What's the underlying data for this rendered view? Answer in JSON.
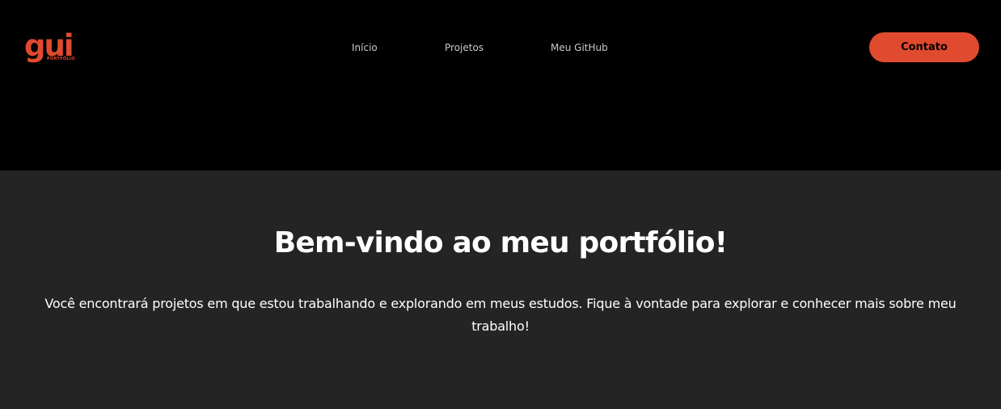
{
  "brand": {
    "logo_text": "gui",
    "logo_subtext": "PORTFÓLIO"
  },
  "nav": {
    "items": [
      {
        "label": "Início"
      },
      {
        "label": "Projetos"
      },
      {
        "label": "Meu GitHub"
      }
    ]
  },
  "header": {
    "contact_label": "Contato"
  },
  "hero": {
    "title": "Bem-vindo ao meu portfólio!",
    "description": "Você encontrará projetos em que estou trabalhando e explorando em meus estudos. Fique à vontade para explorar e conhecer mais sobre meu trabalho!"
  },
  "colors": {
    "accent": "#e04a2f",
    "header_bg": "#000000",
    "hero_bg": "#242424",
    "nav_text": "#c9c9c9",
    "title_text": "#ffffff"
  }
}
